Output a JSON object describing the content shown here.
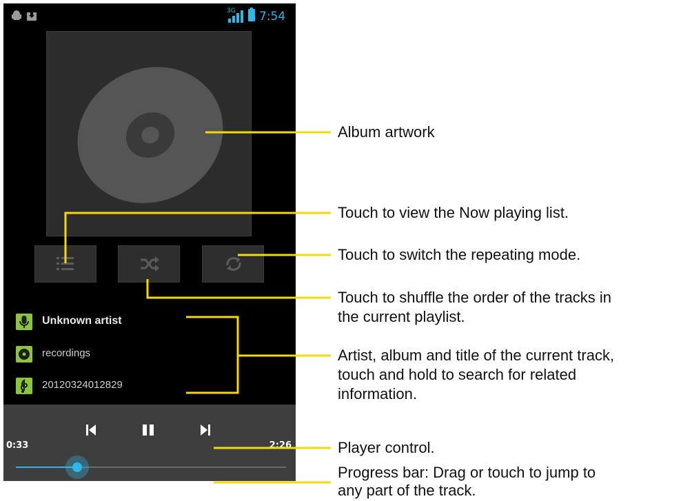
{
  "status_bar": {
    "network_label": "3G",
    "time": "7:54"
  },
  "metadata": {
    "artist": "Unknown artist",
    "album": "recordings",
    "title": "20120324012829"
  },
  "player": {
    "time_elapsed": "0:33",
    "time_total": "2:26",
    "progress_fraction": 0.226
  },
  "annotations": {
    "album_artwork": "Album artwork",
    "now_playing": "Touch to view the Now playing list.",
    "repeat": "Touch to switch the repeating mode.",
    "shuffle_line1": "Touch to shuffle the order of the tracks in",
    "shuffle_line2": "the current playlist.",
    "track_info_line1": "Artist, album and title of the current track,",
    "track_info_line2": "touch and hold to search for related",
    "track_info_line3": "information.",
    "player_control": "Player control.",
    "progress_line1": "Progress bar: Drag or touch to jump to",
    "progress_line2": "any part of the track."
  },
  "colors": {
    "accent": "#33b5e5",
    "icon_green": "#8bc540",
    "callout_line": "#f5d90a"
  }
}
